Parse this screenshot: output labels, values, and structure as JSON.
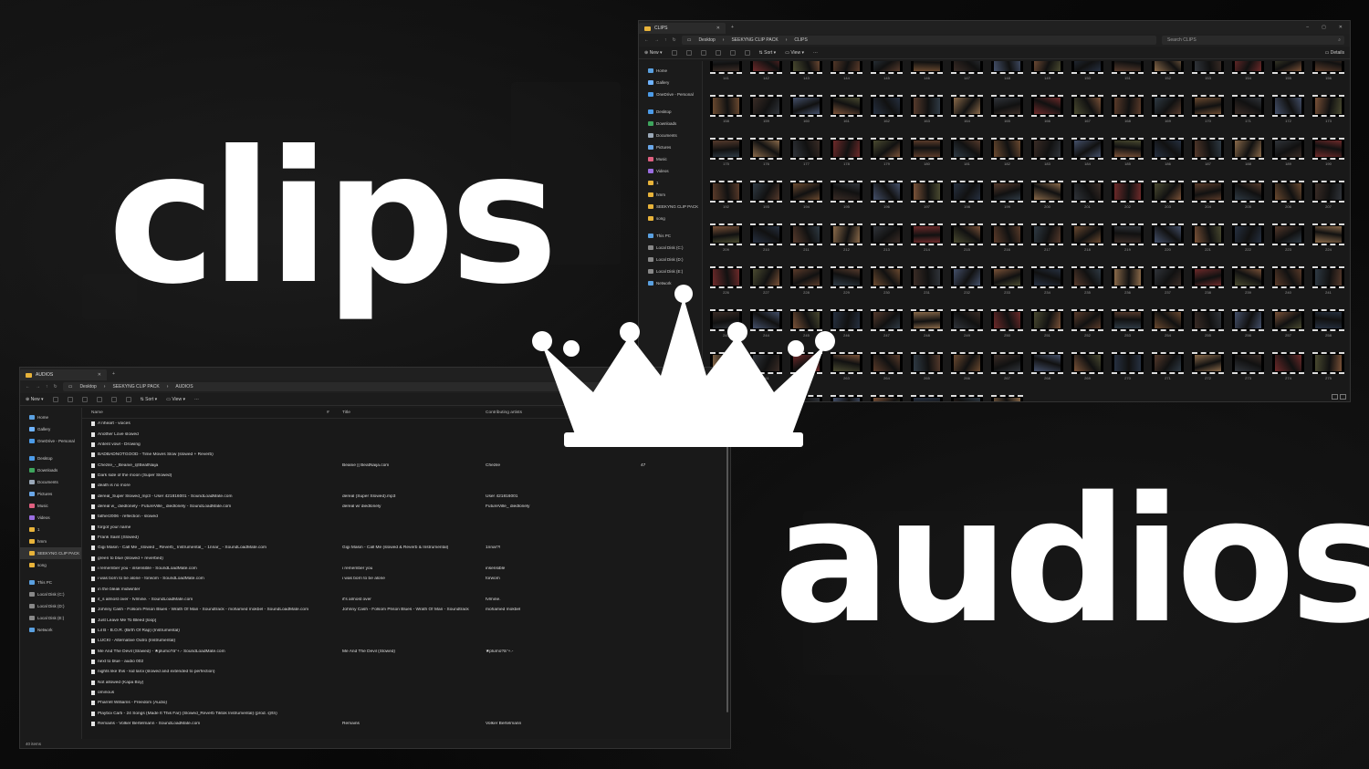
{
  "headline": {
    "clips": "clips",
    "audios": "audios"
  },
  "clips_window": {
    "tab_title": "CLIPS",
    "breadcrumb": [
      "Desktop",
      "SEEKYNG CLIP PACK",
      "CLIPS"
    ],
    "search_placeholder": "Search CLIPS",
    "toolbar": {
      "new": "New",
      "sort": "Sort",
      "view": "View",
      "details": "Details"
    },
    "nav": [
      "Home",
      "Gallery",
      "OneDrive - Personal",
      "Desktop",
      "Downloads",
      "Documents",
      "Pictures",
      "Music",
      "Videos",
      "1",
      "hmm",
      "SEEKYNG CLIP PACK",
      "song",
      "This PC",
      "Local Disk (C:)",
      "Local Disk (D:)",
      "Local Disk (E:)",
      "Network"
    ],
    "first_label": 141,
    "last_label": 284
  },
  "audios_window": {
    "tab_title": "AUDIOS",
    "breadcrumb": [
      "Desktop",
      "SEEKYNG CLIP PACK",
      "AUDIOS"
    ],
    "toolbar": {
      "new": "New",
      "sort": "Sort",
      "view": "View"
    },
    "nav": [
      "Home",
      "Gallery",
      "OneDrive - Personal",
      "Desktop",
      "Downloads",
      "Documents",
      "Pictures",
      "Music",
      "Videos",
      "1",
      "hmm",
      "SEEKYNG CLIP PACK",
      "song",
      "This PC",
      "Local Disk (C:)",
      "Local Disk (D:)",
      "Local Disk (E:)",
      "Network"
    ],
    "columns": {
      "name": "Name",
      "num": "#",
      "title": "Title",
      "artist": "Contributing artists"
    },
    "rows": [
      {
        "name": "Äʼnheart - voices",
        "num": "",
        "title": "",
        "artist": "",
        "album": ""
      },
      {
        "name": "Another Love slowed",
        "num": "",
        "title": "",
        "artist": "",
        "album": ""
      },
      {
        "name": "Antent vowl - Drowing",
        "num": "",
        "title": "",
        "artist": "",
        "album": ""
      },
      {
        "name": "BADBADNOTGOOD - Time Moves Slow (slowed + Reverb)",
        "num": "",
        "title": "",
        "artist": "",
        "album": ""
      },
      {
        "name": "Chezile_-_Beanie_@BeatNaija",
        "num": "",
        "title": "Beanie || BeatNaija.com",
        "artist": "Chezile",
        "album": "47"
      },
      {
        "name": "Dark side of the moon (Super Slowed)",
        "num": "",
        "title": "",
        "artist": "",
        "album": ""
      },
      {
        "name": "death is no more",
        "num": "",
        "title": "",
        "artist": "",
        "album": ""
      },
      {
        "name": "dereal_Super Slowed_mp3 - User 421816001 - SoundLoadMate.com",
        "num": "",
        "title": "dereal (Super Slowed).mp3",
        "artist": "User 421816001",
        "album": ""
      },
      {
        "name": "dereal w_ diedlonely - FutureVille_ diedlonely - SoundLoadMate.com",
        "num": "",
        "title": "dereal w/ diedlonely",
        "artist": "FutureVille_ diedlonely",
        "album": ""
      },
      {
        "name": "father2006 - reflection - slowed",
        "num": "",
        "title": "",
        "artist": "",
        "album": ""
      },
      {
        "name": "forgot your name",
        "num": "",
        "title": "",
        "artist": "",
        "album": ""
      },
      {
        "name": "Frank Saint (Slowed)",
        "num": "",
        "title": "",
        "artist": "",
        "album": ""
      },
      {
        "name": "Gigi Masin - Call Me _slowed _ Reverb_ Instrumental_ - 1nnar_ - SoundLoadMate.com",
        "num": "",
        "title": "Gigi Masin - Call Me (slowed & Reverb & Instrumental)",
        "artist": "1nnar?!",
        "album": ""
      },
      {
        "name": "green to blue (slowed + reverbed)",
        "num": "",
        "title": "",
        "artist": "",
        "album": ""
      },
      {
        "name": "i remember you - insensible - SoundLoadMate.com",
        "num": "",
        "title": "i remember you",
        "artist": "insensible",
        "album": ""
      },
      {
        "name": "i was born to be alone - forwom - SoundLoadMate.com",
        "num": "",
        "title": "i was born to be alone",
        "artist": "forwom",
        "album": ""
      },
      {
        "name": "in the bleak midwinter",
        "num": "",
        "title": "",
        "artist": "",
        "album": ""
      },
      {
        "name": "it_s almost over - fvlmine. - SoundLoadMate.com",
        "num": "",
        "title": "it's almost over",
        "artist": "fvlmine.",
        "album": ""
      },
      {
        "name": "Johnny Cash - Folsom Prison Blues - Wrath Of Man - Soundtrack - mohamed mokbel - SoundLoadMate.com",
        "num": "",
        "title": "Johnny Cash - Folsom Prison Blues - Wrath Of Man - Soundtrack",
        "artist": "mohamed mokbel",
        "album": ""
      },
      {
        "name": "Just Leave Me To Bleed [loop]",
        "num": "",
        "title": "",
        "artist": "",
        "album": ""
      },
      {
        "name": "Lil B - B.O.R. (Birth Of Rap) (Instrumental)",
        "num": "",
        "title": "",
        "artist": "",
        "album": ""
      },
      {
        "name": "LUCKI - Alternative Outro (Instrumental)",
        "num": "",
        "title": "",
        "artist": "",
        "album": ""
      },
      {
        "name": "Me And The Devil (Slowed) - ★plumo?ä°+.- SoundLoadMate.com",
        "num": "",
        "title": "Me And The Devil (Slowed)",
        "artist": "★plumo?ä°+.-",
        "album": ""
      },
      {
        "name": "next to blue - audio 002",
        "num": "",
        "title": "",
        "artist": "",
        "album": ""
      },
      {
        "name": "nights like this - kid laroi (slowed and extended to perfection)",
        "num": "",
        "title": "",
        "artist": "",
        "album": ""
      },
      {
        "name": "Not allowed (Kapa Boy)",
        "num": "",
        "title": "",
        "artist": "",
        "album": ""
      },
      {
        "name": "ominous",
        "num": "",
        "title": "",
        "artist": "",
        "album": ""
      },
      {
        "name": "Pharrell Williams - Freedom (Audio)",
        "num": "",
        "title": "",
        "artist": "",
        "album": ""
      },
      {
        "name": "Playboi Carti - 24 Songs (Made It This Far) (Slowed_Reverb Tiktok Instrumental) (prod. @tri)",
        "num": "",
        "title": "",
        "artist": "",
        "album": ""
      },
      {
        "name": "Remains - Volker Bertelmann - SoundLoadMate.com",
        "num": "",
        "title": "Remains",
        "artist": "Volker Bertelmann",
        "album": ""
      }
    ],
    "status": "40 items"
  },
  "colors": {
    "folder": "#e8b33a",
    "text": "#dddddd",
    "window_bg": "#1b1b1b"
  },
  "icons": [
    "crown-icon",
    "folder-icon",
    "file-icon",
    "search-icon"
  ]
}
